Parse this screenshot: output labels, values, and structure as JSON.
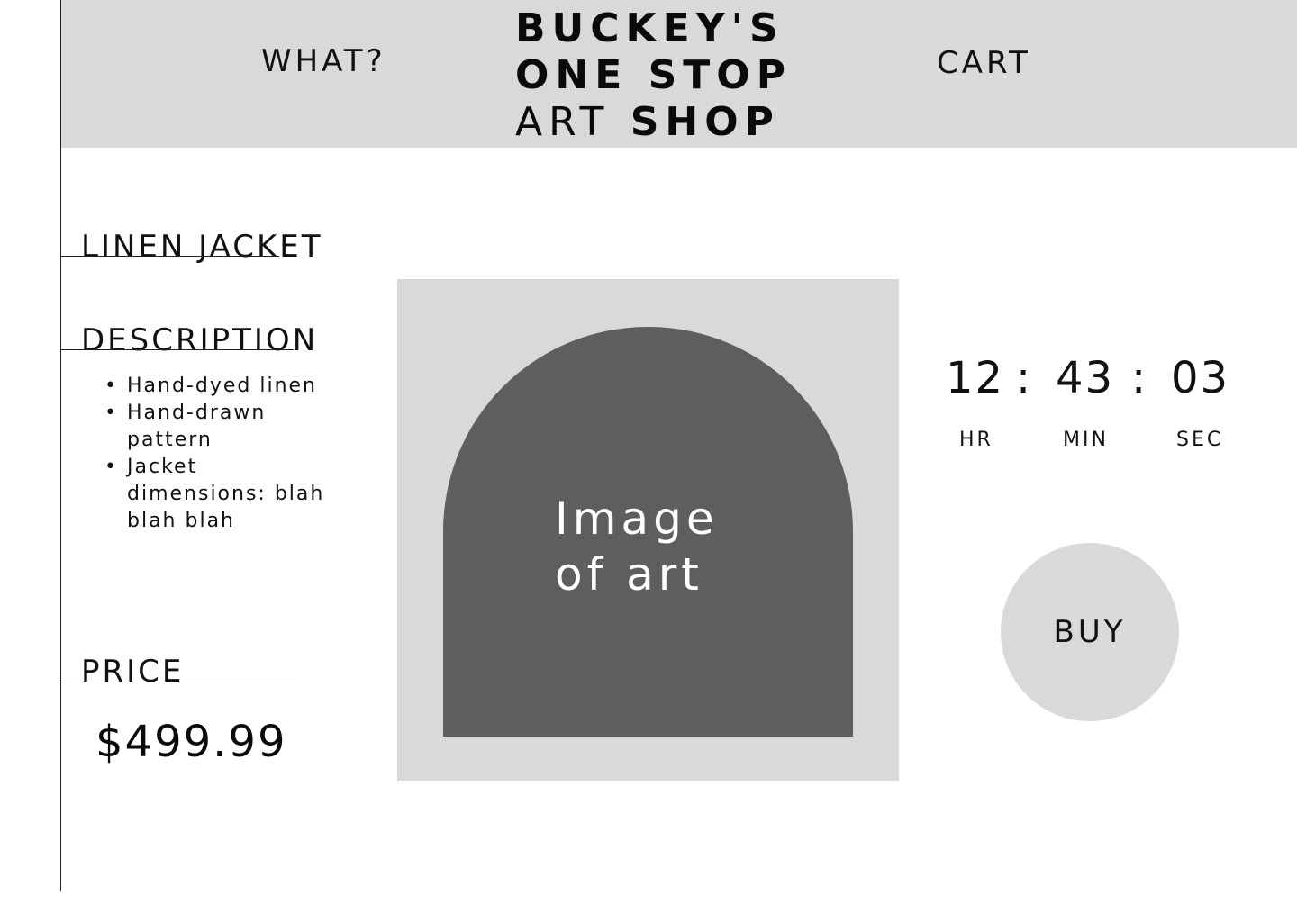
{
  "header": {
    "nav_what": "WHAT?",
    "nav_cart": "CART",
    "logo": {
      "line1": "BUCKEY'S",
      "line2": "ONE STOP",
      "line3_a": "ART",
      "line3_b": "SHOP"
    }
  },
  "product": {
    "name": "LINEN JACKET",
    "description_title": "DESCRIPTION",
    "description_items": [
      "Hand-dyed linen",
      "Hand-drawn pattern",
      "Jacket dimensions: blah blah blah"
    ],
    "price_title": "PRICE",
    "price": "$499.99",
    "image_caption_line1": "Image",
    "image_caption_line2": "of art"
  },
  "timer": {
    "hours": "12",
    "minutes": "43",
    "seconds": "03",
    "separator": ":",
    "hr_label": "HR",
    "min_label": "MIN",
    "sec_label": "SEC"
  },
  "actions": {
    "buy_label": "BUY"
  },
  "colors": {
    "header_bg": "#d9d9d9",
    "arch_fill": "#5e5e5e",
    "text": "#111111"
  }
}
